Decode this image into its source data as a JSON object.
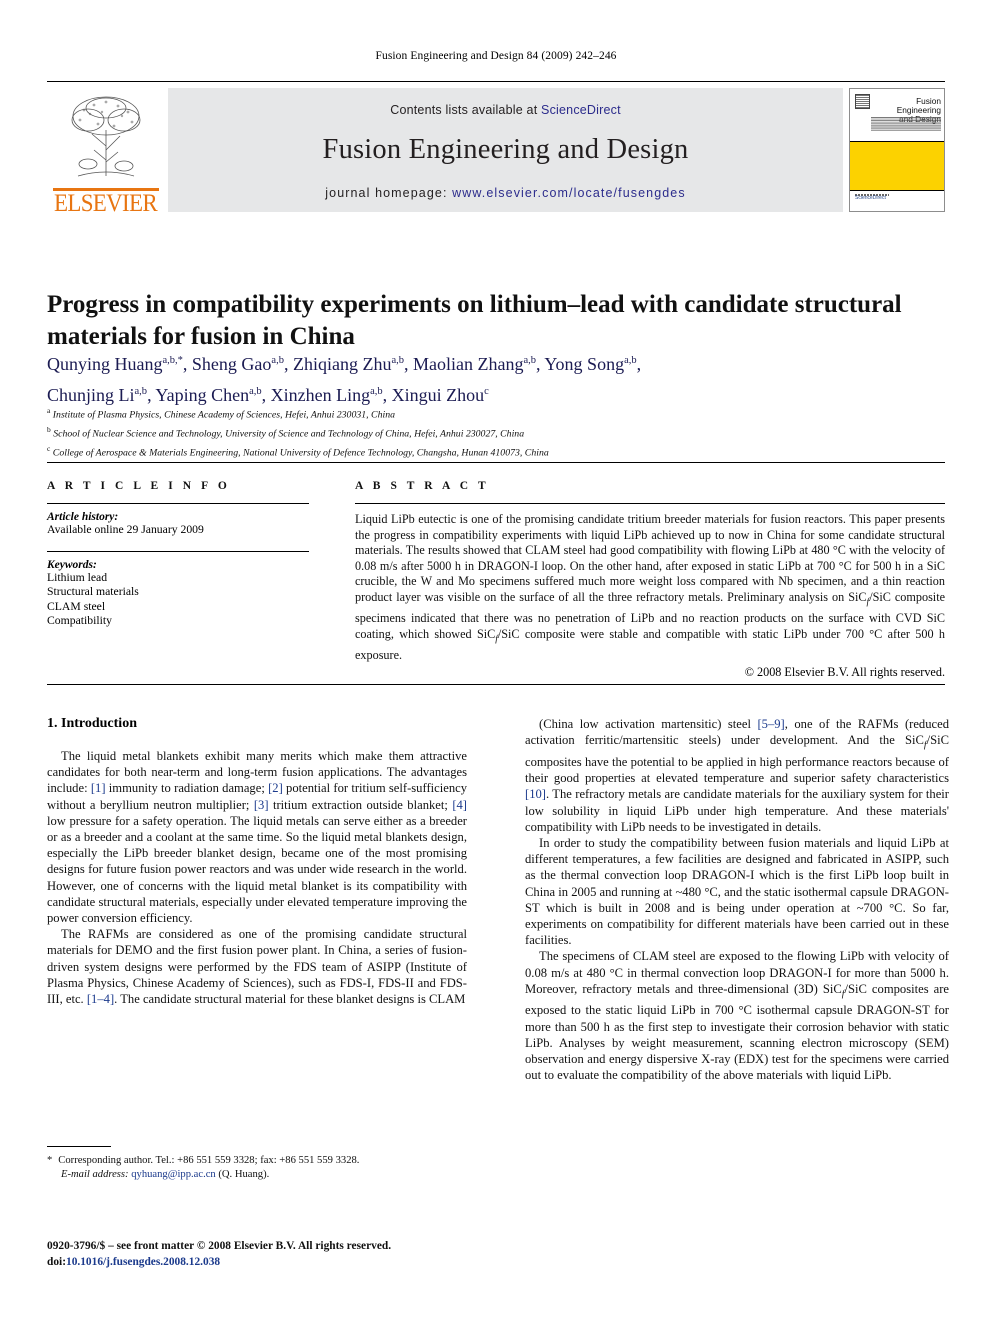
{
  "running_head": "Fusion Engineering and Design 84 (2009) 242–246",
  "journal_header": {
    "contents_prefix": "Contents lists available at ",
    "sciencedirect": "ScienceDirect",
    "journal_title": "Fusion Engineering and Design",
    "homepage_prefix": "journal homepage: ",
    "homepage_url": "www.elsevier.com/locate/fusengdes",
    "publisher_name": "ELSEVIER",
    "accent_orange": "#e87511",
    "link_blue": "#2c2c8c",
    "band_gray": "#e6e7e8"
  },
  "cover": {
    "title_line1": "Fusion Engineering",
    "title_line2": "and Design",
    "yellow": "#fcd200",
    "bottom_mark": "ScienceDirect"
  },
  "article": {
    "title": "Progress in compatibility experiments on lithium–lead with candidate structural materials for fusion in China",
    "authors_line1_html": "Qunying Huang<sup>a,b,*</sup>, Sheng Gao<sup>a,b</sup>, Zhiqiang Zhu<sup>a,b</sup>, Maolian Zhang<sup>a,b</sup>, Yong Song<sup>a,b</sup>,",
    "authors_line2_html": "Chunjing Li<sup>a,b</sup>, Yaping Chen<sup>a,b</sup>, Xinzhen Ling<sup>a,b</sup>, Xingui Zhou<sup>c</sup>",
    "affiliations": [
      {
        "marker": "a",
        "text": "Institute of Plasma Physics, Chinese Academy of Sciences, Hefei, Anhui 230031, China"
      },
      {
        "marker": "b",
        "text": "School of Nuclear Science and Technology, University of Science and Technology of China, Hefei, Anhui 230027, China"
      },
      {
        "marker": "c",
        "text": "College of Aerospace & Materials Engineering, National University of Defence Technology, Changsha, Hunan 410073, China"
      }
    ]
  },
  "article_info": {
    "heading": "A R T I C L E   I N F O",
    "history_label": "Article history:",
    "history_value": "Available online 29 January 2009",
    "keywords_label": "Keywords:",
    "keywords": [
      "Lithium lead",
      "Structural materials",
      "CLAM steel",
      "Compatibility"
    ]
  },
  "abstract": {
    "heading": "A B S T R A C T",
    "text": "Liquid LiPb eutectic is one of the promising candidate tritium breeder materials for fusion reactors. This paper presents the progress in compatibility experiments with liquid LiPb achieved up to now in China for some candidate structural materials. The results showed that CLAM steel had good compatibility with flowing LiPb at 480 °C with the velocity of 0.08 m/s after 5000 h in DRAGON-I loop. On the other hand, after exposed in static LiPb at 700 °C for 500 h in a SiC crucible, the W and Mo specimens suffered much more weight loss compared with Nb specimen, and a thin reaction product layer was visible on the surface of all the three refractory metals. Preliminary analysis on SiCf/SiC composite specimens indicated that there was no penetration of LiPb and no reaction products on the surface with CVD SiC coating, which showed SiCf/SiC composite were stable and compatible with static LiPb under 700 °C after 500 h exposure.",
    "copyright": "© 2008 Elsevier B.V. All rights reserved."
  },
  "body": {
    "section_number_title": "1.  Introduction",
    "left_paragraphs": [
      "The liquid metal blankets exhibit many merits which make them attractive candidates for both near-term and long-term fusion applications. The advantages include: [1] immunity to radiation damage; [2] potential for tritium self-sufficiency without a beryllium neutron multiplier; [3] tritium extraction outside blanket; [4] low pressure for a safety operation. The liquid metals can serve either as a breeder or as a breeder and a coolant at the same time. So the liquid metal blankets design, especially the LiPb breeder blanket design, became one of the most promising designs for future fusion power reactors and was under wide research in the world. However, one of concerns with the liquid metal blanket is its compatibility with candidate structural materials, especially under elevated temperature improving the power conversion efficiency.",
      "The RAFMs are considered as one of the promising candidate structural materials for DEMO and the first fusion power plant. In China, a series of fusion-driven system designs were performed by the FDS team of ASIPP (Institute of Plasma Physics, Chinese Academy of Sciences), such as FDS-I, FDS-II and FDS-III, etc. [1–4]. The candidate structural material for these blanket designs is CLAM"
    ],
    "right_paragraphs": [
      "(China low activation martensitic) steel [5–9], one of the RAFMs (reduced activation ferritic/martensitic steels) under development. And the SiCf/SiC composites have the potential to be applied in high performance reactors because of their good properties at elevated temperature and superior safety characteristics [10]. The refractory metals are candidate materials for the auxiliary system for their low solubility in liquid LiPb under high temperature. And these materials' compatibility with LiPb needs to be investigated in details.",
      "In order to study the compatibility between fusion materials and liquid LiPb at different temperatures, a few facilities are designed and fabricated in ASIPP, such as the thermal convection loop DRAGON-I which is the first LiPb loop built in China in 2005 and running at ~480 °C, and the static isothermal capsule DRAGON-ST which is built in 2008 and is being under operation at ~700 °C. So far, experiments on compatibility for different materials have been carried out in these facilities.",
      "The specimens of CLAM steel are exposed to the flowing LiPb with velocity of 0.08 m/s at 480 °C in thermal convection loop DRAGON-I for more than 5000 h. Moreover, refractory metals and three-dimensional (3D) SiCf/SiC composites are exposed to the static liquid LiPb in 700 °C isothermal capsule DRAGON-ST for more than 500 h as the first step to investigate their corrosion behavior with static LiPb. Analyses by weight measurement, scanning electron microscopy (SEM) observation and energy dispersive X-ray (EDX) test for the specimens were carried out to evaluate the compatibility of the above materials with liquid LiPb."
    ],
    "reference_markers": [
      "[1]",
      "[2]",
      "[3]",
      "[4]",
      "[1–4]",
      "[5–9]",
      "[10]"
    ]
  },
  "footnotes": {
    "corresponding_star": "*",
    "corresponding_text": "Corresponding author. Tel.: +86 551 559 3328; fax: +86 551 559 3328.",
    "email_label": "E-mail address:",
    "email": "qyhuang@ipp.ac.cn",
    "email_suffix": "(Q. Huang).",
    "issn_line": "0920-3796/$ – see front matter © 2008 Elsevier B.V. All rights reserved.",
    "doi_label": "doi:",
    "doi_value": "10.1016/j.fusengdes.2008.12.038"
  }
}
